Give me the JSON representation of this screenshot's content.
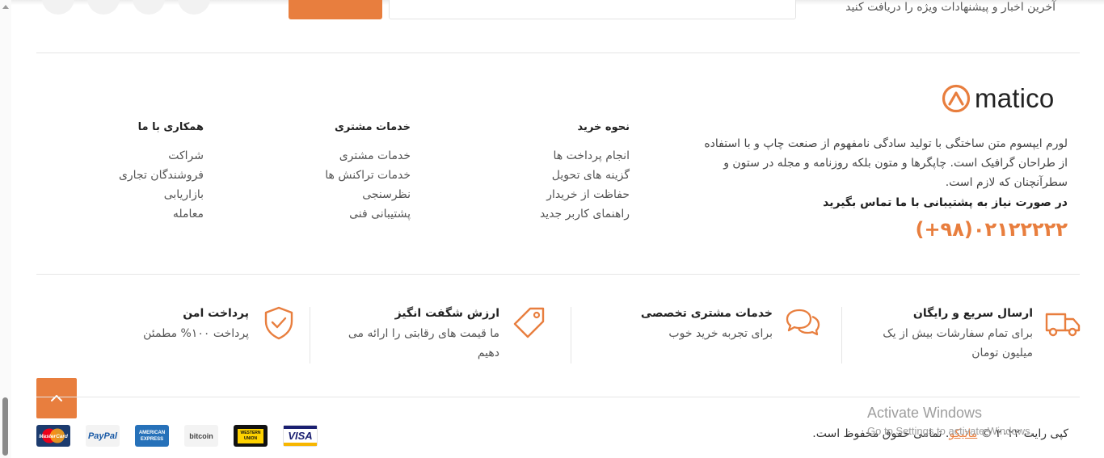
{
  "newsletter": {
    "text": "آخرین اخبار و پیشنهادات ویژه را دریافت کنید",
    "email_placeholder": ""
  },
  "brand": {
    "logo_text": "matico",
    "about": "لورم ایپسوم متن ساختگی با تولید سادگی نامفهوم از صنعت چاپ و با استفاده از طراحان گرافیک است. چاپگرها و متون بلکه روزنامه و مجله در ستون و سطرآنچنان که لازم است.",
    "support_title": "در صورت نیاز به پشتیبانی با ما تماس بگیرید",
    "phone": "(+۹۸)۰۲۱۲۲۲۲۲"
  },
  "columns": [
    {
      "title": "نحوه خرید",
      "links": [
        "انجام پرداخت ها",
        "گزینه های تحویل",
        "حفاظت از خریدار",
        "راهنمای کاربر جدید"
      ]
    },
    {
      "title": "خدمات مشتری",
      "links": [
        "خدمات مشتری",
        "خدمات تراکنش ها",
        "نظرسنجی",
        "پشتیبانی فنی"
      ]
    },
    {
      "title": "همکاری با ما",
      "links": [
        "شراکت",
        "فروشندگان تجاری",
        "بازاریابی",
        "معامله"
      ]
    }
  ],
  "features": [
    {
      "icon": "truck-icon",
      "title": "ارسال سریع و رایگان",
      "desc": "برای تمام سفارشات بیش از یک میلیون تومان"
    },
    {
      "icon": "chat-bubbles-icon",
      "title": "خدمات مشتری تخصصی",
      "desc": "برای تجربه خرید خوب"
    },
    {
      "icon": "price-tag-icon",
      "title": "ارزش شگفت انگیز",
      "desc": "ما قیمت های رقابتی را ارائه می دهیم"
    },
    {
      "icon": "shield-check-icon",
      "title": "پرداخت امن",
      "desc": "پرداخت ۱۰۰% مطمئن"
    }
  ],
  "payments": [
    "VISA",
    "WESTERN UNION",
    "bitcoin",
    "AMERICAN EXPRESS",
    "PayPal",
    "MasterCard"
  ],
  "copyright": {
    "before": "کپی رایت ۲۰۲۲ © ",
    "brand": "ماتیکو",
    "after": ". تمامی حقوق محفوظ است."
  },
  "windows_watermark": {
    "line1": "Activate Windows",
    "line2": "Go to Settings to activate Windows."
  },
  "colors": {
    "accent": "#e87e3e",
    "text": "#333333",
    "divider": "#e5e5e5"
  }
}
